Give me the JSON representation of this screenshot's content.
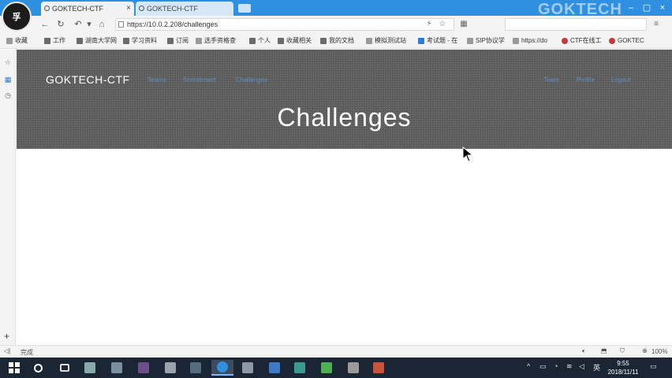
{
  "browser": {
    "avatar_text": "孚",
    "tabs": [
      {
        "title": "GOKTECH-CTF",
        "active": true
      },
      {
        "title": "GOKTECH-CTF",
        "active": false
      }
    ],
    "watermark": "GOKTECH",
    "url": "https://10.0.2.208/challenges",
    "bookmarks": [
      {
        "label": "收藏",
        "folder": false
      },
      {
        "label": "工作",
        "folder": true
      },
      {
        "label": "湖南大学网",
        "folder": true
      },
      {
        "label": "学习资料",
        "folder": true
      },
      {
        "label": "订阅",
        "folder": true
      },
      {
        "label": "选手资格查",
        "folder": false
      },
      {
        "label": "个人",
        "folder": true
      },
      {
        "label": "收藏相关",
        "folder": true
      },
      {
        "label": "我的文档",
        "folder": true
      },
      {
        "label": "模拟测试站",
        "folder": false
      },
      {
        "label": "考试题 - 在",
        "folder": false
      },
      {
        "label": "SIP协议学",
        "folder": false
      },
      {
        "label": "https://do",
        "folder": false
      },
      {
        "label": "CTF在线工",
        "folder": false
      },
      {
        "label": "GOKTEC",
        "folder": false
      }
    ],
    "status_left": "完成",
    "zoom": "100%"
  },
  "site": {
    "brand": "GOKTECH-CTF",
    "nav_left": [
      "Teams",
      "Scoreboard",
      "Challenges"
    ],
    "nav_right": [
      "Team",
      "Profile",
      "Logout"
    ],
    "page_title": "Challenges"
  },
  "taskbar": {
    "time": "9:55",
    "date": "2018/11/11",
    "ime": "英",
    "colors": {
      "active_app": "#3c4b5e",
      "bg": "#1b2634"
    }
  }
}
